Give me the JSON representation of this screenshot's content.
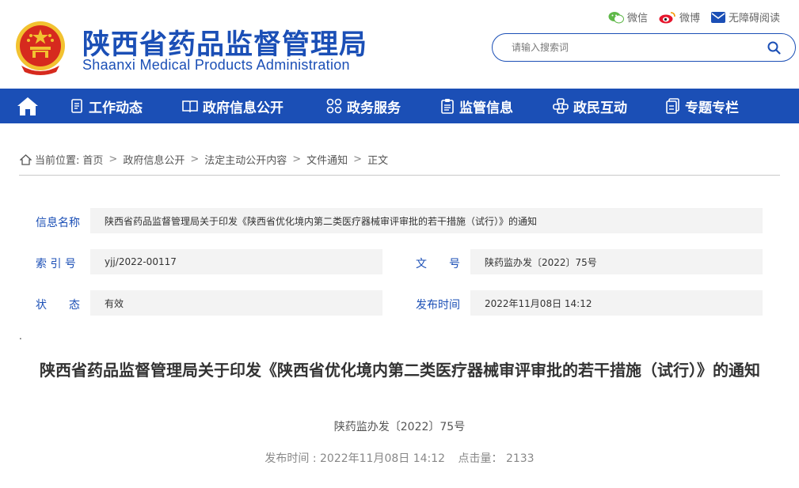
{
  "header": {
    "site_title": "陕西省药品监督管理局",
    "site_subtitle": "Shaanxi Medical Products Administration",
    "links": {
      "wechat": "微信",
      "weibo": "微博",
      "accessibility": "无障碍阅读"
    },
    "search_placeholder": "请输入搜索词"
  },
  "nav": {
    "home_icon": "home-icon",
    "items": [
      {
        "label": "工作动态",
        "icon": "document-list-icon"
      },
      {
        "label": "政府信息公开",
        "icon": "open-book-icon"
      },
      {
        "label": "政务服务",
        "icon": "grid-icon"
      },
      {
        "label": "监管信息",
        "icon": "clipboard-icon"
      },
      {
        "label": "政民互动",
        "icon": "interaction-icon"
      },
      {
        "label": "专题专栏",
        "icon": "folder-icon"
      }
    ]
  },
  "breadcrumb": {
    "prefix": "当前位置:",
    "items": [
      "首页",
      "政府信息公开",
      "法定主动公开内容",
      "文件通知",
      "正文"
    ]
  },
  "info": {
    "name_label": "信息名称",
    "name_value": "陕西省药品监督管理局关于印发《陕西省优化境内第二类医疗器械审评审批的若干措施（试行）》的通知",
    "index_label": "索 引 号",
    "index_value": "yjj/2022-00117",
    "docno_label": "文　　号",
    "docno_value": "陕药监办发〔2022〕75号",
    "status_label": "状　　态",
    "status_value": "有效",
    "date_label": "发布时间",
    "date_value": "2022年11月08日 14:12"
  },
  "article": {
    "dot": ".",
    "title": "陕西省药品监督管理局关于印发《陕西省优化境内第二类医疗器械审评审批的若干措施（试行）》的通知",
    "doc_number": "陕药监办发〔2022〕75号",
    "publish_time": "发布时间 : 2022年11月08日 14:12",
    "views": "点击量： 2133"
  },
  "colors": {
    "brand_blue": "#1b4fb6",
    "emblem_red": "#d62a1e",
    "emblem_gold": "#f2c230"
  }
}
